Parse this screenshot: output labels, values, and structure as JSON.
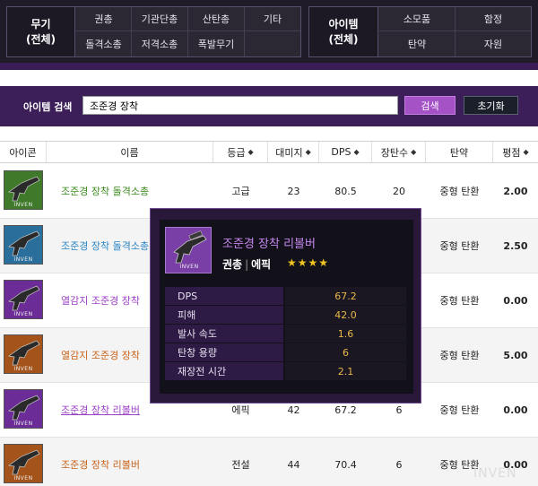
{
  "top_categories": {
    "weapon_main": "무기\n(전체)",
    "weapon_items": [
      "권총",
      "기관단총",
      "산탄총",
      "기타",
      "돌격소총",
      "저격소총",
      "폭발무기"
    ],
    "item_main": "아이템\n(전체)",
    "item_items": [
      "소모품",
      "함정",
      "탄약",
      "자원"
    ]
  },
  "search": {
    "label": "아이템 검색",
    "value": "조준경 장착",
    "button": "검색",
    "reset": "초기화"
  },
  "table": {
    "headers": [
      "아이콘",
      "이름",
      "등급",
      "대미지",
      "DPS",
      "장탄수",
      "탄약",
      "평점"
    ],
    "rows": [
      {
        "name": "조준경 장착 돌격소총",
        "grade": "고급",
        "damage": "23",
        "dps": "80.5",
        "mag": "20",
        "ammo": "중형 탄환",
        "score": "2.00"
      },
      {
        "name": "조준경 장착 돌격소총",
        "grade": "",
        "damage": "",
        "dps": "",
        "mag": "",
        "ammo": "중형 탄환",
        "score": "2.50"
      },
      {
        "name": "열감지 조준경 장착",
        "grade": "",
        "damage": "",
        "dps": "",
        "mag": "",
        "ammo": "중형 탄환",
        "score": "0.00"
      },
      {
        "name": "열감지 조준경 장착",
        "grade": "",
        "damage": "",
        "dps": "",
        "mag": "",
        "ammo": "중형 탄환",
        "score": "5.00"
      },
      {
        "name": "조준경 장착 리볼버",
        "grade": "에픽",
        "damage": "42",
        "dps": "67.2",
        "mag": "6",
        "ammo": "중형 탄환",
        "score": "0.00"
      },
      {
        "name": "조준경 장착 리볼버",
        "grade": "전설",
        "damage": "44",
        "dps": "70.4",
        "mag": "6",
        "ammo": "중형 탄환",
        "score": "0.00"
      }
    ]
  },
  "tooltip": {
    "name": "조준경 장착 리볼버",
    "type": "권총",
    "sep": "|",
    "rarity": "에픽",
    "stars": "★★★★",
    "stats": [
      {
        "label": "DPS",
        "value": "67.2"
      },
      {
        "label": "피해",
        "value": "42.0"
      },
      {
        "label": "발사 속도",
        "value": "1.6"
      },
      {
        "label": "탄창 용량",
        "value": "6"
      },
      {
        "label": "재장전 시간",
        "value": "2.1"
      }
    ]
  },
  "icon_text": "INVEN",
  "watermark": "INVEN",
  "colors": {
    "rarity_uncommon": "#3d8a1f",
    "rarity_rare": "#2b86c5",
    "rarity_epic": "#9b3fc4",
    "rarity_legendary": "#c8621a",
    "icon_uncommon": "#3f7a2a",
    "icon_rare": "#2a6f9c",
    "icon_epic": "#6b2c98",
    "icon_legendary": "#a4541a"
  },
  "row_rarity": [
    "uncommon",
    "rare",
    "epic",
    "legendary",
    "epic",
    "legendary"
  ]
}
